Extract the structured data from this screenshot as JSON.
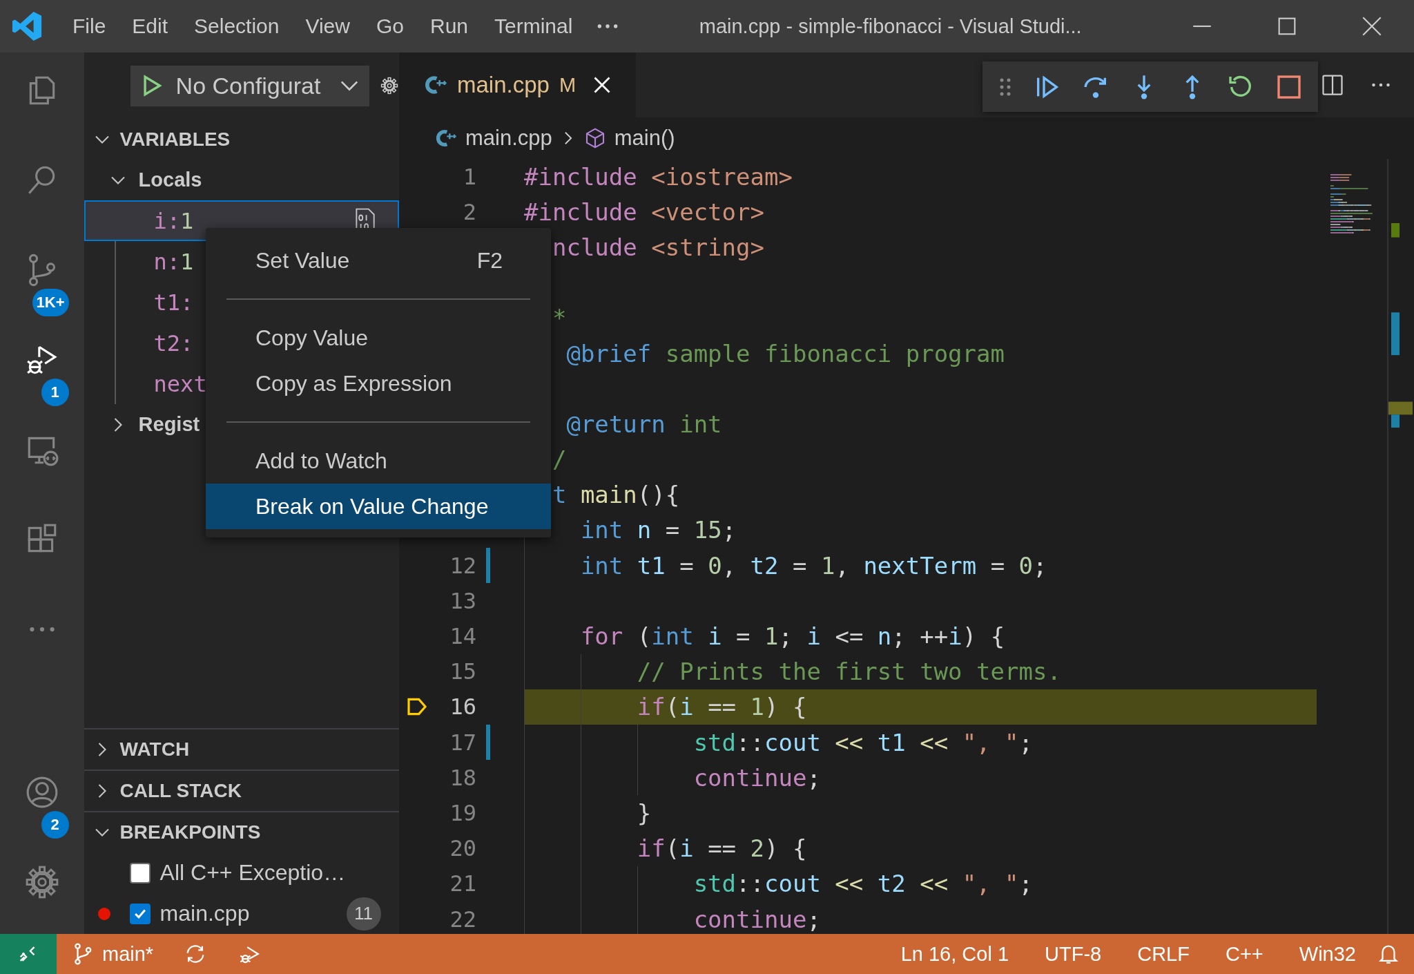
{
  "title_bar": {
    "menus": [
      "File",
      "Edit",
      "Selection",
      "View",
      "Go",
      "Run",
      "Terminal"
    ],
    "title": "main.cpp - simple-fibonacci - Visual Studi..."
  },
  "activity_bar": {
    "top": [
      {
        "kind": "explorer",
        "selected": false
      },
      {
        "kind": "search",
        "selected": false
      },
      {
        "kind": "source-control",
        "selected": false,
        "badge": "1K+"
      },
      {
        "kind": "run-debug",
        "selected": true,
        "badge": "1"
      },
      {
        "kind": "remote",
        "selected": false
      },
      {
        "kind": "extensions",
        "selected": false
      },
      {
        "kind": "more",
        "selected": false
      }
    ],
    "bottom": [
      {
        "kind": "account",
        "selected": false,
        "badge": "2"
      },
      {
        "kind": "settings",
        "selected": false
      }
    ]
  },
  "sidebar": {
    "run_config": "No Configurat",
    "variables": {
      "title": "VARIABLES",
      "expanded": true,
      "scopes": [
        {
          "label": "Locals",
          "expanded": true,
          "children": [
            {
              "name": "i:",
              "value": "1",
              "selected": true
            },
            {
              "name": "n:",
              "value": "1",
              "selected": false
            },
            {
              "name": "t1:",
              "selected": false
            },
            {
              "name": "t2:",
              "selected": false
            },
            {
              "name": "next",
              "selected": false
            }
          ]
        },
        {
          "label": "Regist",
          "expanded": false
        }
      ]
    },
    "sections": [
      {
        "title": "WATCH",
        "expanded": false
      },
      {
        "title": "CALL STACK",
        "expanded": false
      },
      {
        "title": "BREAKPOINTS",
        "expanded": true,
        "items": [
          {
            "kind": "exception",
            "label": "All C++ Exceptio…",
            "checked": false
          },
          {
            "kind": "file",
            "label": "main.cpp",
            "checked": true,
            "count": "11"
          }
        ]
      }
    ]
  },
  "editor": {
    "tabs": [
      {
        "label": "main.cpp",
        "status": "M",
        "selected": true
      }
    ],
    "breadcrumb": [
      {
        "kind": "file",
        "label": "main.cpp"
      },
      {
        "kind": "function",
        "label": "main()"
      }
    ],
    "lines": [
      {
        "number": "1",
        "current": false,
        "modified": false,
        "tokens": [
          {
            "kind": "ctl",
            "text": "#include"
          },
          {
            "kind": "str",
            "text": " <iostream>"
          }
        ]
      },
      {
        "number": "2",
        "current": false,
        "modified": false,
        "tokens": [
          {
            "kind": "ctl",
            "text": "#include"
          },
          {
            "kind": "str",
            "text": " <vector>"
          }
        ]
      },
      {
        "current": false,
        "tokens": [
          {
            "kind": "ctl",
            "text": "  nclude"
          },
          {
            "kind": "str",
            "text": " <string>"
          }
        ]
      },
      {
        "current": false
      },
      {
        "current": false,
        "tokens": [
          {
            "kind": "cmt",
            "text": "  *"
          }
        ]
      },
      {
        "current": false,
        "tokens": [
          {
            "kind": "tag",
            "text": "   @brief"
          },
          {
            "kind": "cmt",
            "text": " sample fibonacci program"
          }
        ]
      },
      {
        "current": false
      },
      {
        "current": false,
        "tokens": [
          {
            "kind": "tag",
            "text": "   @return"
          },
          {
            "kind": "cmt",
            "text": " int"
          }
        ]
      },
      {
        "current": false,
        "tokens": [
          {
            "kind": "cmt",
            "text": "  /"
          }
        ]
      },
      {
        "current": false,
        "tokens": [
          {
            "kind": "kw",
            "text": "  t"
          },
          {
            "kind": "fn",
            "text": " main"
          },
          {
            "kind": "p",
            "text": "(){"
          }
        ]
      },
      {
        "current": false,
        "tokens": [
          {
            "kind": "kw",
            "text": "    int"
          },
          {
            "kind": "var",
            "text": " n"
          },
          {
            "kind": "p",
            "text": " = "
          },
          {
            "kind": "num",
            "text": "15"
          },
          {
            "kind": "p",
            "text": ";"
          }
        ]
      },
      {
        "number": "12",
        "current": false,
        "modified": true,
        "tokens": [
          {
            "kind": "kw",
            "text": "    int"
          },
          {
            "kind": "var",
            "text": " t1"
          },
          {
            "kind": "p",
            "text": " = "
          },
          {
            "kind": "num",
            "text": "0"
          },
          {
            "kind": "p",
            "text": ", "
          },
          {
            "kind": "var",
            "text": "t2"
          },
          {
            "kind": "p",
            "text": " = "
          },
          {
            "kind": "num",
            "text": "1"
          },
          {
            "kind": "p",
            "text": ", "
          },
          {
            "kind": "var",
            "text": "nextTerm"
          },
          {
            "kind": "p",
            "text": " = "
          },
          {
            "kind": "num",
            "text": "0"
          },
          {
            "kind": "p",
            "text": ";"
          }
        ]
      },
      {
        "number": "13",
        "current": false,
        "modified": false
      },
      {
        "number": "14",
        "current": false,
        "modified": false,
        "tokens": [
          {
            "kind": "ctl",
            "text": "    for"
          },
          {
            "kind": "p",
            "text": " ("
          },
          {
            "kind": "kw",
            "text": "int"
          },
          {
            "kind": "var",
            "text": " i"
          },
          {
            "kind": "p",
            "text": " = "
          },
          {
            "kind": "num",
            "text": "1"
          },
          {
            "kind": "p",
            "text": "; "
          },
          {
            "kind": "var",
            "text": "i"
          },
          {
            "kind": "p",
            "text": " <= "
          },
          {
            "kind": "var",
            "text": "n"
          },
          {
            "kind": "p",
            "text": "; ++"
          },
          {
            "kind": "var",
            "text": "i"
          },
          {
            "kind": "p",
            "text": ") {"
          }
        ]
      },
      {
        "number": "15",
        "current": false,
        "modified": false,
        "tokens": [
          {
            "kind": "cmt",
            "text": "        // Prints the first two terms."
          }
        ]
      },
      {
        "number": "16",
        "current": true,
        "modified": false,
        "tokens": [
          {
            "kind": "ctl",
            "text": "        if"
          },
          {
            "kind": "p",
            "text": "("
          },
          {
            "kind": "var",
            "text": "i"
          },
          {
            "kind": "p",
            "text": " == "
          },
          {
            "kind": "num",
            "text": "1"
          },
          {
            "kind": "p",
            "text": ") {"
          }
        ]
      },
      {
        "number": "17",
        "current": false,
        "modified": true,
        "tokens": [
          {
            "kind": "ns",
            "text": "            std"
          },
          {
            "kind": "p",
            "text": "::"
          },
          {
            "kind": "var",
            "text": "cout"
          },
          {
            "kind": "op",
            "text": " <<"
          },
          {
            "kind": "var",
            "text": " t1"
          },
          {
            "kind": "op",
            "text": " <<"
          },
          {
            "kind": "str",
            "text": " \", \""
          },
          {
            "kind": "p",
            "text": ";"
          }
        ]
      },
      {
        "number": "18",
        "current": false,
        "modified": false,
        "tokens": [
          {
            "kind": "ctl",
            "text": "            continue"
          },
          {
            "kind": "p",
            "text": ";"
          }
        ]
      },
      {
        "number": "19",
        "current": false,
        "modified": false,
        "tokens": [
          {
            "kind": "p",
            "text": "        }"
          }
        ]
      },
      {
        "number": "20",
        "current": false,
        "modified": false,
        "tokens": [
          {
            "kind": "ctl",
            "text": "        if"
          },
          {
            "kind": "p",
            "text": "("
          },
          {
            "kind": "var",
            "text": "i"
          },
          {
            "kind": "p",
            "text": " == "
          },
          {
            "kind": "num",
            "text": "2"
          },
          {
            "kind": "p",
            "text": ") {"
          }
        ]
      },
      {
        "number": "21",
        "current": false,
        "modified": false,
        "tokens": [
          {
            "kind": "ns",
            "text": "            std"
          },
          {
            "kind": "p",
            "text": "::"
          },
          {
            "kind": "var",
            "text": "cout"
          },
          {
            "kind": "op",
            "text": " <<"
          },
          {
            "kind": "var",
            "text": " t2"
          },
          {
            "kind": "op",
            "text": " <<"
          },
          {
            "kind": "str",
            "text": " \", \""
          },
          {
            "kind": "p",
            "text": ";"
          }
        ]
      },
      {
        "number": "22",
        "current": false,
        "modified": false,
        "tokens": [
          {
            "kind": "ctl",
            "text": "            continue"
          },
          {
            "kind": "p",
            "text": ";"
          }
        ]
      }
    ]
  },
  "context_menu": {
    "groups": [
      [
        {
          "label": "Set Value",
          "shortcut": "F2",
          "selected": false
        }
      ],
      [
        {
          "label": "Copy Value",
          "selected": false
        },
        {
          "label": "Copy as Expression",
          "selected": false
        }
      ],
      [
        {
          "label": "Add to Watch",
          "selected": false
        },
        {
          "label": "Break on Value Change",
          "selected": true
        }
      ]
    ]
  },
  "status_bar": {
    "left": [
      {
        "kind": "remote"
      },
      {
        "kind": "branch",
        "text": "main*"
      },
      {
        "kind": "sync"
      },
      {
        "kind": "debug"
      }
    ],
    "right": [
      "Ln 16, Col 1",
      "UTF-8",
      "CRLF",
      "C++",
      "Win32"
    ]
  }
}
